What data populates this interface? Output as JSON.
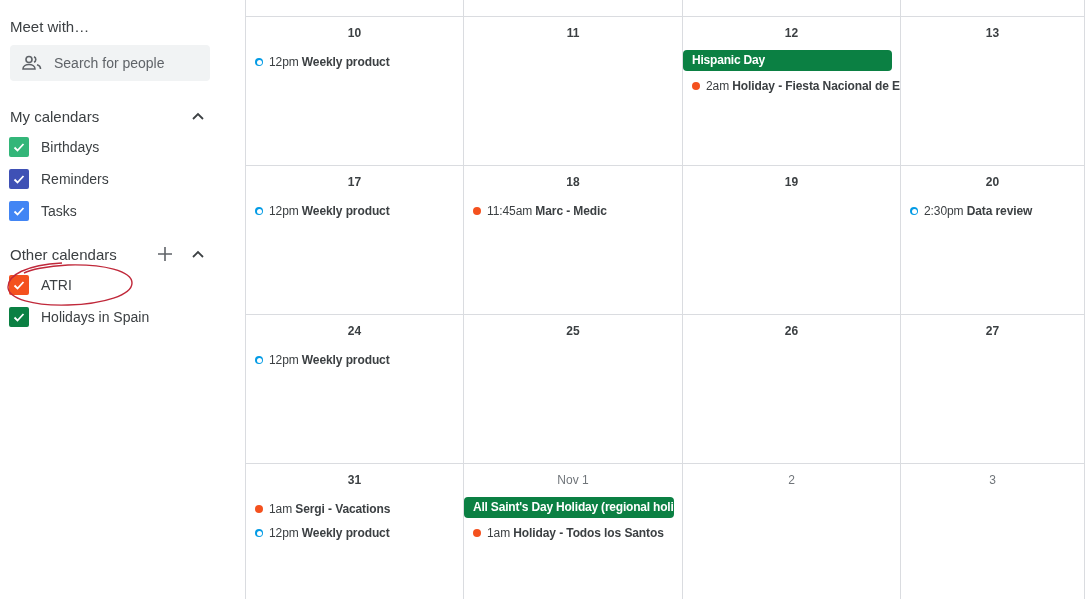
{
  "sidebar": {
    "meet_title": "Meet with…",
    "search": {
      "placeholder": "Search for people"
    },
    "sections": [
      {
        "title": "My calendars",
        "expanded": true,
        "can_add": false,
        "calendars": [
          {
            "name": "Birthdays",
            "checked": true,
            "color": "#33b679"
          },
          {
            "name": "Reminders",
            "checked": true,
            "color": "#3f51b5"
          },
          {
            "name": "Tasks",
            "checked": true,
            "color": "#4285f4"
          }
        ]
      },
      {
        "title": "Other calendars",
        "expanded": true,
        "can_add": true,
        "calendars": [
          {
            "name": "ATRI",
            "checked": true,
            "color": "#f4511e",
            "circled": true
          },
          {
            "name": "Holidays in Spain",
            "checked": true,
            "color": "#0b8043"
          }
        ]
      }
    ]
  },
  "weeks": [
    {
      "days": [
        {
          "date": "10",
          "other_month": false,
          "events": [
            {
              "kind": "timed",
              "time": "12pm",
              "title": "Weekly product",
              "filled": false,
              "color": "#039be5"
            }
          ]
        },
        {
          "date": "11",
          "other_month": false
        },
        {
          "date": "12",
          "other_month": false,
          "events": [
            {
              "kind": "allday",
              "title": "Hispanic Day",
              "color": "#0b8043"
            },
            {
              "kind": "timed",
              "time": "2am",
              "title": "Holiday - Fiesta Nacional de E",
              "filled": true,
              "color": "#f4511e"
            }
          ]
        },
        {
          "date": "13",
          "other_month": false
        }
      ]
    },
    {
      "days": [
        {
          "date": "17",
          "other_month": false,
          "events": [
            {
              "kind": "timed",
              "time": "12pm",
              "title": "Weekly product",
              "filled": false,
              "color": "#039be5"
            }
          ]
        },
        {
          "date": "18",
          "other_month": false,
          "events": [
            {
              "kind": "timed",
              "time": "11:45am",
              "title": "Marc - Medic",
              "filled": true,
              "color": "#f4511e"
            }
          ]
        },
        {
          "date": "19",
          "other_month": false
        },
        {
          "date": "20",
          "other_month": false,
          "events": [
            {
              "kind": "timed",
              "time": "2:30pm",
              "title": "Data review",
              "filled": false,
              "color": "#039be5"
            }
          ]
        }
      ]
    },
    {
      "days": [
        {
          "date": "24",
          "other_month": false,
          "events": [
            {
              "kind": "timed",
              "time": "12pm",
              "title": "Weekly product",
              "filled": false,
              "color": "#039be5"
            }
          ]
        },
        {
          "date": "25",
          "other_month": false
        },
        {
          "date": "26",
          "other_month": false
        },
        {
          "date": "27",
          "other_month": false
        }
      ]
    },
    {
      "days": [
        {
          "date": "31",
          "other_month": false,
          "events": [
            {
              "kind": "timed",
              "time": "1am",
              "title": "Sergi - Vacations",
              "filled": true,
              "color": "#f4511e"
            },
            {
              "kind": "timed",
              "time": "12pm",
              "title": "Weekly product",
              "filled": false,
              "color": "#039be5"
            }
          ]
        },
        {
          "date": "Nov 1",
          "other_month": true,
          "events": [
            {
              "kind": "allday",
              "title": "All Saint's Day Holiday (regional holi",
              "color": "#0b8043"
            },
            {
              "kind": "timed",
              "time": "1am",
              "title": "Holiday - Todos los Santos",
              "filled": true,
              "color": "#f4511e"
            }
          ]
        },
        {
          "date": "2",
          "other_month": true
        },
        {
          "date": "3",
          "other_month": true
        }
      ]
    }
  ]
}
